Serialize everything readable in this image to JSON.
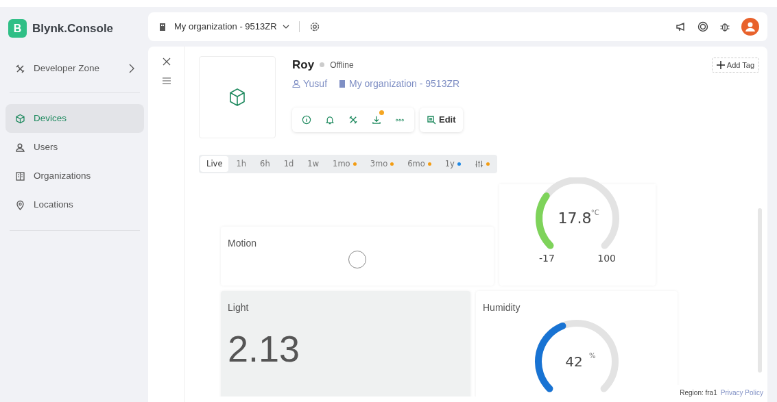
{
  "brand": {
    "logo_letter": "B",
    "name": "Blynk.Console"
  },
  "sidebar": {
    "items": [
      {
        "label": "Developer Zone",
        "selected": false
      },
      {
        "label": "Devices",
        "selected": true
      },
      {
        "label": "Users",
        "selected": false
      },
      {
        "label": "Organizations",
        "selected": false
      },
      {
        "label": "Locations",
        "selected": false
      }
    ]
  },
  "topbar": {
    "organization": "My organization - 9513ZR"
  },
  "device": {
    "name": "Roy",
    "status": "Offline",
    "online": false,
    "owner": "Yusuf",
    "organization": "My organization - 9513ZR",
    "actions": [
      {
        "badge": false
      },
      {
        "badge": false
      },
      {
        "badge": false
      },
      {
        "badge": true
      },
      {
        "badge": false
      }
    ],
    "edit_label": "Edit",
    "add_tag_label": "Add Tag"
  },
  "ranges": [
    {
      "kind": "text",
      "label": "Live",
      "selected": true
    },
    {
      "kind": "text",
      "label": "1h",
      "selected": false
    },
    {
      "kind": "text",
      "label": "6h",
      "selected": false
    },
    {
      "kind": "text",
      "label": "1d",
      "selected": false
    },
    {
      "kind": "text",
      "label": "1w",
      "selected": false
    },
    {
      "kind": "text",
      "label": "1mo",
      "selected": false,
      "color": "#f39c12"
    },
    {
      "kind": "text",
      "label": "3mo",
      "selected": false,
      "color": "#f39c12"
    },
    {
      "kind": "text",
      "label": "6mo",
      "selected": false,
      "color": "#f39c12"
    },
    {
      "kind": "text",
      "label": "1y",
      "selected": false,
      "color": "#1e88e5"
    },
    {
      "kind": "icon",
      "selected": false,
      "color": "#f39c12"
    }
  ],
  "widgets": {
    "temperature": {
      "value": "17.8",
      "unit": "°C",
      "min": "-17",
      "max": "100"
    },
    "motion": {
      "title": "Motion",
      "on": false
    },
    "light": {
      "title": "Light",
      "value": "2.13"
    },
    "humidity": {
      "title": "Humidity",
      "value": "42",
      "unit": "%"
    }
  },
  "footer": {
    "region": "Region: fra1",
    "privacy_link": "Privacy Policy"
  }
}
